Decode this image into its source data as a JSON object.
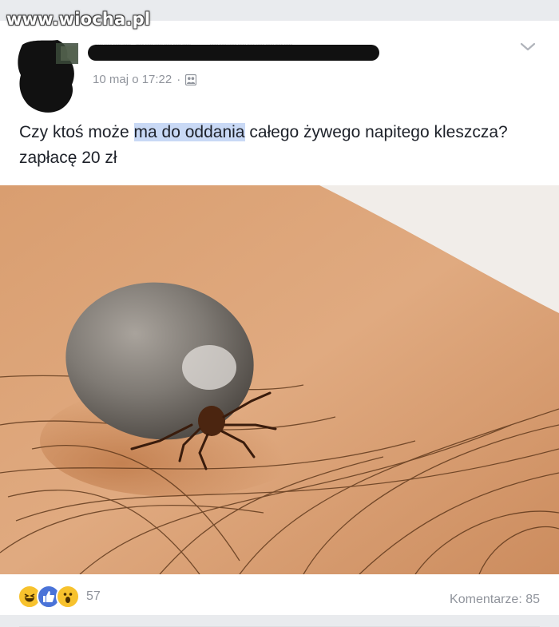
{
  "watermark": "www.wiocha.pl",
  "post": {
    "author_line": "▒▒▒▒ ▒▒▒▒▒▒ ▶ ▒▒▒▒▒▒▒▒▒",
    "date": "10 maj o 17:22",
    "separator": "·",
    "audience_icon": "group-icon",
    "text_before": "Czy ktoś może ",
    "text_highlight": "ma do oddania",
    "text_after": " całego żywego napitego kleszcza? zapłacę 20 zł",
    "image_icon": "tick-photo"
  },
  "footer": {
    "reaction_icons": [
      "haha-icon",
      "like-icon",
      "wow-icon"
    ],
    "reaction_count": "57",
    "comments_label": "Komentarze: 85"
  },
  "colors": {
    "card_bg": "#ffffff",
    "page_bg": "#e9ebee",
    "meta_text": "#90949c",
    "body_text": "#1d2129",
    "highlight": "#c9d9f5",
    "like_blue": "#4a73d8",
    "emoji_yellow": "#f7c22d"
  }
}
